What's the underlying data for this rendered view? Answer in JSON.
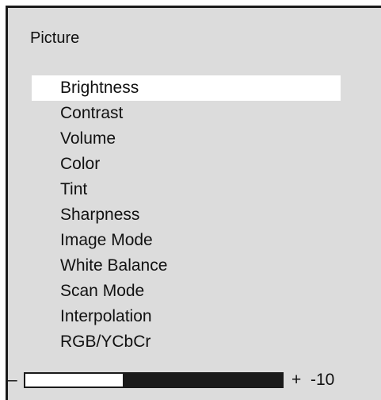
{
  "menu": {
    "title": "Picture",
    "selected_index": 0,
    "items": [
      {
        "label": "Brightness"
      },
      {
        "label": "Contrast"
      },
      {
        "label": "Volume"
      },
      {
        "label": "Color"
      },
      {
        "label": "Tint"
      },
      {
        "label": "Sharpness"
      },
      {
        "label": "Image Mode"
      },
      {
        "label": "White Balance"
      },
      {
        "label": "Scan Mode"
      },
      {
        "label": "Interpolation"
      },
      {
        "label": "RGB/YCbCr"
      }
    ]
  },
  "slider": {
    "minus_label": "–",
    "plus_label": "+",
    "value_text": "-10",
    "fill_fraction": 0.38
  },
  "colors": {
    "panel_background": "#dcdcdc",
    "selection_highlight": "#ffffff",
    "border": "#1a1a1a"
  }
}
